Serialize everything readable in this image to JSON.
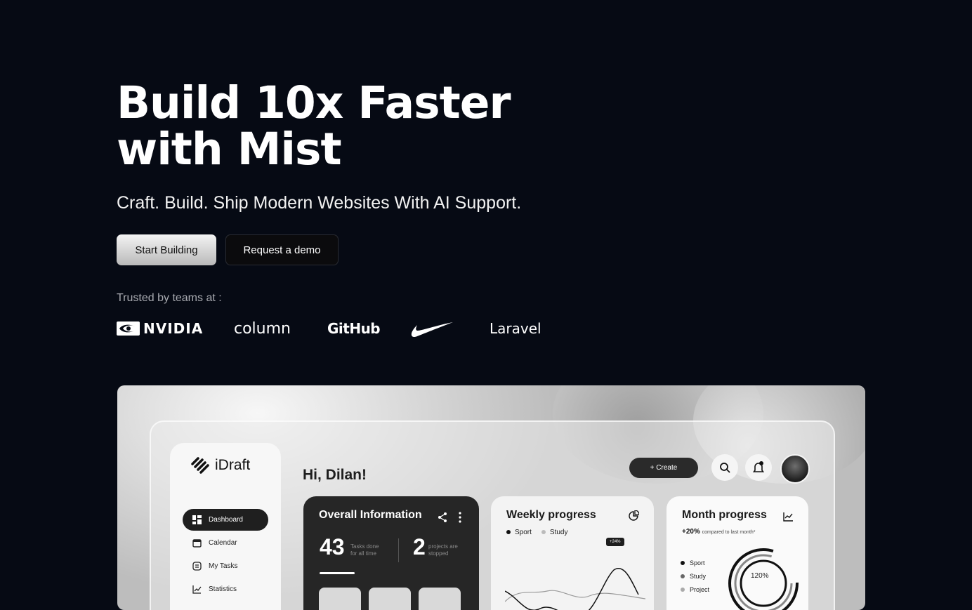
{
  "hero": {
    "title_line1": "Build 10x Faster",
    "title_line2": "with Mist",
    "subtitle": "Craft. Build. Ship Modern Websites With AI Support."
  },
  "buttons": {
    "primary": "Start Building",
    "secondary": "Request a demo"
  },
  "trusted": {
    "label": "Trusted by teams at :",
    "logos": [
      "NVIDIA",
      "column",
      "GitHub",
      "Nike",
      "Laravel"
    ]
  },
  "mockup": {
    "brand": "iDraft",
    "greeting": "Hi, Dilan!",
    "create_label": "+ Create",
    "nav": [
      "Dashboard",
      "Calendar",
      "My Tasks",
      "Statistics"
    ],
    "overall": {
      "title": "Overall Information",
      "tasks_num": "43",
      "tasks_txt1": "Tasks done",
      "tasks_txt2": "for all time",
      "projects_num": "2",
      "projects_txt1": "projects are",
      "projects_txt2": "stopped"
    },
    "weekly": {
      "title": "Weekly progress",
      "legend1": "Sport",
      "legend2": "Study",
      "badge": "+24%"
    },
    "month": {
      "title": "Month progress",
      "delta": "+20%",
      "delta_note": "compared to last month*",
      "items": [
        "Sport",
        "Study",
        "Project"
      ],
      "ring_value": "120%"
    }
  },
  "colors": {
    "background": "#060a14",
    "primary_button": "#d8d8d8",
    "secondary_button": "#0b0b0d"
  },
  "icons": [
    "nvidia-logo",
    "nike-swoosh",
    "search-icon",
    "bell-icon",
    "share-icon",
    "more-icon",
    "chart-icon"
  ]
}
